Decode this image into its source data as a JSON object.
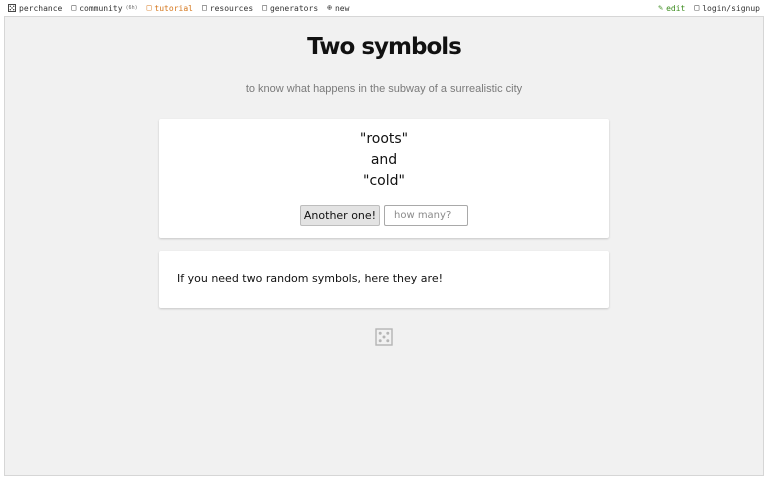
{
  "nav": {
    "left": [
      {
        "label": "perchance",
        "icon": "dice-icon"
      },
      {
        "label": "community",
        "badge": "(6h)",
        "icon": "chat-icon"
      },
      {
        "label": "tutorial",
        "icon": "book-icon",
        "color": "#d4751a"
      },
      {
        "label": "resources",
        "icon": "resources-icon"
      },
      {
        "label": "generators",
        "icon": "generators-icon"
      },
      {
        "label": "new",
        "icon": "plus-circle-icon"
      }
    ],
    "right": [
      {
        "label": "edit",
        "icon": "pencil-icon",
        "color": "#3c8c1e"
      },
      {
        "label": "login/signup",
        "icon": "user-icon"
      }
    ]
  },
  "page": {
    "title": "Two symbols",
    "subtitle": "to know what happens in the subway of a surrealistic city"
  },
  "output": {
    "line1": "\"roots\"",
    "line2": "and",
    "line3": "\"cold\"",
    "button_label": "Another one!",
    "count_placeholder": "how many?"
  },
  "info": {
    "text": "If you need two random symbols, here they are!"
  },
  "colors": {
    "background": "#f1f1f1",
    "card": "#ffffff",
    "tutorial": "#d4751a",
    "edit": "#3c8c1e"
  }
}
